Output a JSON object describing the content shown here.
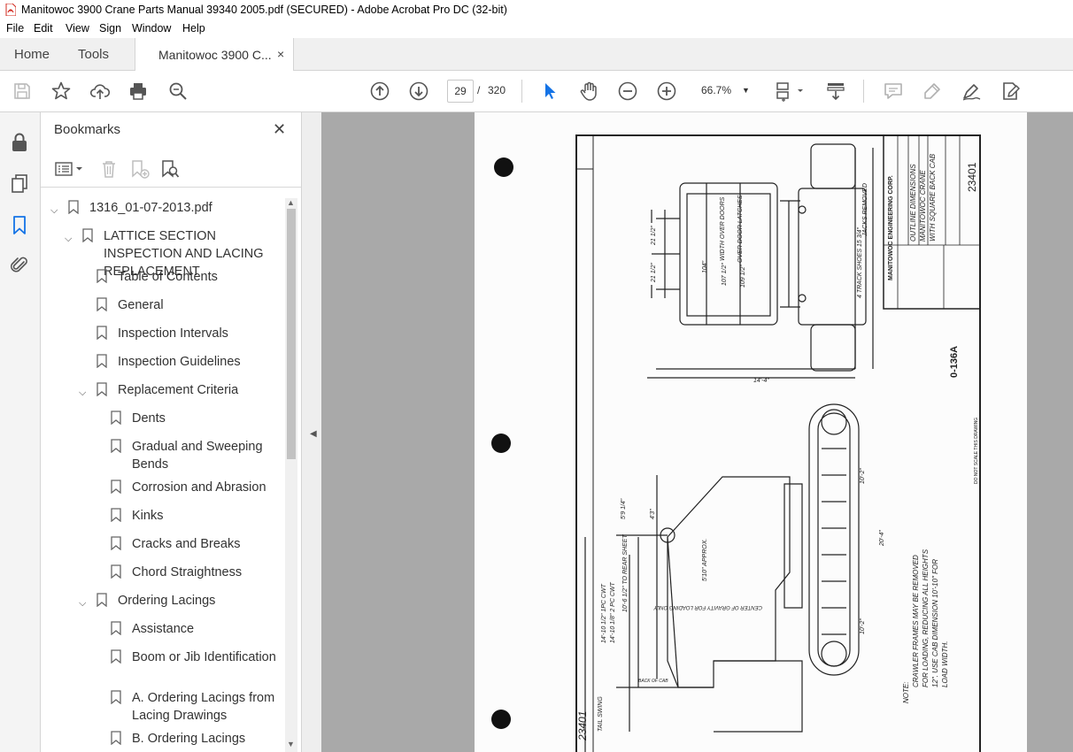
{
  "window": {
    "title": "Manitowoc 3900 Crane Parts Manual 39340 2005.pdf (SECURED) - Adobe Acrobat Pro DC (32-bit)",
    "app_icon": "acrobat-icon"
  },
  "menu": [
    "File",
    "Edit",
    "View",
    "Sign",
    "Window",
    "Help"
  ],
  "tabs": {
    "home": "Home",
    "tools": "Tools",
    "document": "Manitowoc 3900 C...",
    "close": "×"
  },
  "toolbar": {
    "current_page": "29",
    "separator": "/",
    "total_pages": "320",
    "zoom": "66.7%",
    "icons": [
      "save-icon",
      "bookmark-star-icon",
      "share-upload-icon",
      "print-icon",
      "find-icon",
      "previous-page-icon",
      "next-page-icon",
      "select-cursor-icon",
      "hand-tool-icon",
      "zoom-out-icon",
      "zoom-in-icon",
      "page-layout-icon",
      "scroll-mode-icon",
      "comment-icon",
      "highlight-icon",
      "sign-icon",
      "edit-pdf-icon"
    ]
  },
  "rail": [
    "lock-icon",
    "pages-icon",
    "bookmarks-icon",
    "attachments-icon"
  ],
  "bookmarks": {
    "title": "Bookmarks",
    "close": "✕",
    "items": [
      {
        "label": "1316_01-07-2013.pdf",
        "level": 0,
        "expanded": true
      },
      {
        "label": "LATTICE SECTION INSPECTION AND LACING REPLACEMENT",
        "level": 1,
        "expanded": true
      },
      {
        "label": "Table of Contents",
        "level": 2
      },
      {
        "label": "General",
        "level": 2
      },
      {
        "label": "Inspection Intervals",
        "level": 2
      },
      {
        "label": "Inspection Guidelines",
        "level": 2
      },
      {
        "label": "Replacement Criteria",
        "level": 2,
        "expanded": true
      },
      {
        "label": "Dents",
        "level": 3
      },
      {
        "label": "Gradual and Sweeping Bends",
        "level": 3
      },
      {
        "label": "Corrosion and Abrasion",
        "level": 3
      },
      {
        "label": "Kinks",
        "level": 3
      },
      {
        "label": "Cracks and Breaks",
        "level": 3
      },
      {
        "label": "Chord Straightness",
        "level": 3
      },
      {
        "label": "Ordering Lacings",
        "level": 2,
        "expanded": true
      },
      {
        "label": "Assistance",
        "level": 3
      },
      {
        "label": "Boom or Jib Identification",
        "level": 3
      },
      {
        "label": "A. Ordering Lacings from Lacing Drawings",
        "level": 3
      },
      {
        "label": "B. Ordering Lacings",
        "level": 3
      }
    ]
  },
  "drawing": {
    "company": "MANITOWOC ENGINEERING CORP.",
    "title1": "OUTLINE DIMENSIONS",
    "title2": "MANITOWOC CRANE",
    "title3": "WITH SQUARE BACK CAB",
    "drawing_no": "23401",
    "sheet_code": "0-136A",
    "scale_note": "DO NOT SCALE THIS DRAWING",
    "note_label": "NOTE:",
    "note_1": "CRAWLER FRAMES MAY BE REMOVED",
    "note_2": "FOR LOADING, REDUCING ALL HEIGHTS",
    "note_3": "12\". USE CAB DIMENSION 10'-10\" FOR",
    "note_4": "LOAD WIDTH.",
    "dims": {
      "width_over_doors": "WIDTH OVER DOORS",
      "over_door_latches": "OVER DOOR LATCHES",
      "track_shoes": "4 TRACK SHOES 15 3/4\"",
      "jacks_removed": "JACKS REMOVED",
      "d_104": "104\"",
      "d_107": "107 1/2\"",
      "d_109": "109 1/2\"",
      "d_21a": "21 1/2\"",
      "d_21b": "21 1/2\"",
      "d_14_4": "14'-4\"",
      "d_10_2a": "10'-2\"",
      "d_20_4": "20'-4\"",
      "d_10_2b": "10'-2\"",
      "d_5_10": "5'10\" APPROX.",
      "d_1pc": "14'-10 1/2\" 1PC CWT",
      "d_2pc": "14'-10 1/8\" 2 PC CWT",
      "d_rear": "10'-6 1/2\" TO REAR SHEET",
      "d_9_4": "5'9 1/4\"",
      "d_4_3": "4'3\"",
      "back_of_cab": "BACK OF CAB",
      "tail_swing": "TAIL SWING",
      "gravity": "CENTER OF GRAVITY FOR LOADING ONLY",
      "stamp": "23401"
    }
  }
}
